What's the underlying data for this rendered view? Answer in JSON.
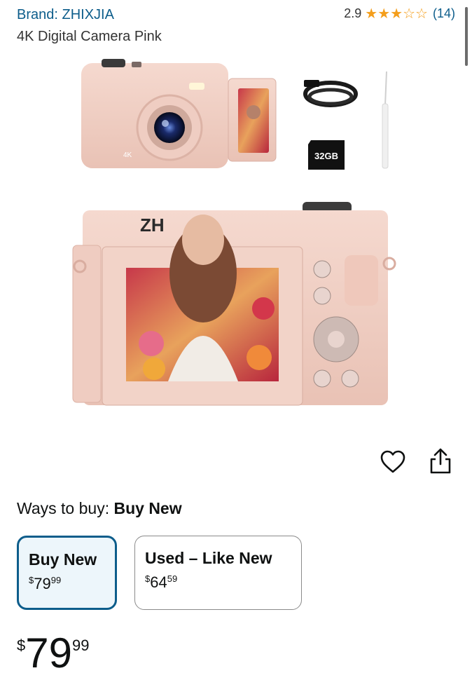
{
  "header": {
    "brand": "Brand: ZHIXJIA",
    "title": "4K Digital Camera Pink",
    "rating_value": "2.9",
    "rating_stars": 2.9,
    "rating_count": "(14)"
  },
  "gallery": {
    "sd_card_label": "32GB",
    "camera_brand_text": "ZH",
    "lens_badge": "4K"
  },
  "actions": {
    "favorite_icon": "heart-icon",
    "share_icon": "share-icon"
  },
  "buying": {
    "ways_prefix": "Ways to buy:",
    "ways_selected": "Buy New",
    "options": [
      {
        "label": "Buy New",
        "symbol": "$",
        "whole": "79",
        "cents": "99"
      },
      {
        "label": "Used – Like New",
        "symbol": "$",
        "whole": "64",
        "cents": "59"
      }
    ]
  },
  "price": {
    "symbol": "$",
    "whole": "79",
    "cents": "99"
  },
  "colors": {
    "link": "#0d5d8b",
    "star": "#f49e1b",
    "selected_border": "#0d5d8b",
    "selected_bg": "#edf6fb",
    "camera_pink": "#f2d2c7"
  }
}
